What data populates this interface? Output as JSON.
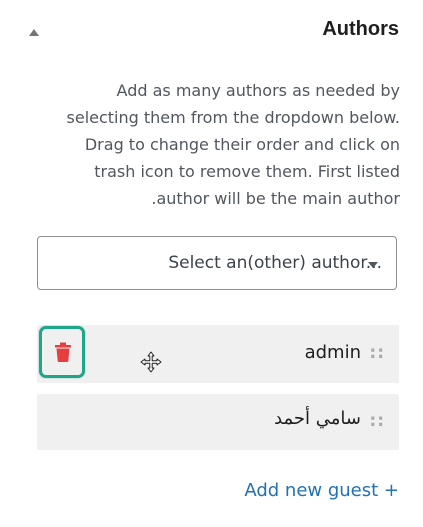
{
  "panel": {
    "title": "Authors",
    "collapse_icon": "triangle-up-icon",
    "description": "Add as many authors as needed by selecting them from the dropdown below. Drag to change their order and click on trash icon to remove them. First listed author will be the main author."
  },
  "select": {
    "placeholder": "Select an(other) author...",
    "caret_icon": "caret-down-icon"
  },
  "authors": [
    {
      "name": "admin",
      "drag_handle": "::",
      "trash_icon": "trash-icon",
      "cursor_icon": "move-cursor-icon"
    },
    {
      "name": "سامي أحمد",
      "drag_handle": "::"
    }
  ],
  "add_guest": {
    "label": "Add new guest +"
  },
  "colors": {
    "row_background": "#f0f0f0",
    "highlight_border": "#1ea58a",
    "trash_red": "#e53e3e",
    "link_blue": "#2271b1"
  }
}
